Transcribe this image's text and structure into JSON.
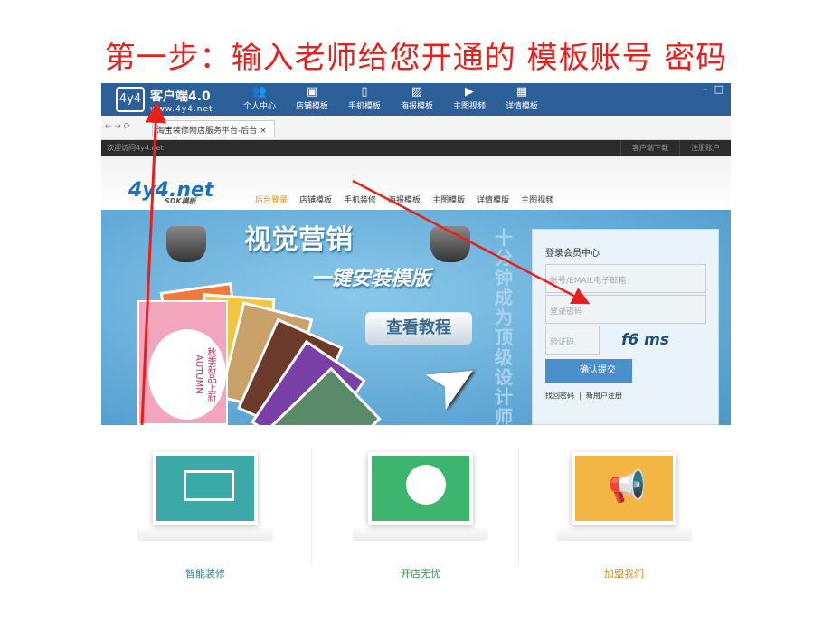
{
  "slide_title": "第一步：输入老师给您开通的 模板账号 密码",
  "app": {
    "logo": "4y4",
    "name": "客户端4.0",
    "url": "www.4y4.net",
    "nav": [
      {
        "label": "个人中心",
        "icon": "user-icon"
      },
      {
        "label": "店铺模板",
        "icon": "store-icon"
      },
      {
        "label": "手机模板",
        "icon": "phone-icon"
      },
      {
        "label": "海报模板",
        "icon": "image-icon"
      },
      {
        "label": "主图视频",
        "icon": "video-icon"
      },
      {
        "label": "详情模板",
        "icon": "picture-icon"
      }
    ],
    "window_controls": [
      "–",
      "□"
    ]
  },
  "browser": {
    "tab_title": "淘宝装修网店服务平台-后台",
    "close": "×"
  },
  "site": {
    "welcome": "欢迎访问4y4.net",
    "top_links": [
      "客户端下载",
      "注册账户"
    ],
    "logo": "4y4.net",
    "logo_sub": "SDK模板",
    "nav": [
      "后台登录",
      "店铺模板",
      "手机装修",
      "海报模板",
      "主图模版",
      "详情模版",
      "主图视频"
    ],
    "banner": {
      "headline": "视觉营销",
      "subhead": "一键安装模版",
      "tutorial_button": "查看教程",
      "vertical_text": "十分钟成为顶级设计师",
      "card_text": "秋季新品上新",
      "card_en": "AUTUMN"
    },
    "login": {
      "title": "登录会员中心",
      "account_placeholder": "帐号/EMAIL电子邮箱",
      "password_placeholder": "登录密码",
      "captcha_placeholder": "验证码",
      "captcha": "f6 ms",
      "submit": "确认提交",
      "forgot": "找回密码",
      "register": "新用户注册"
    }
  },
  "features": [
    {
      "label": "智能装修",
      "color": "#3aa9a8",
      "label_color": "#2f8a8a"
    },
    {
      "label": "开店无忧",
      "color": "#3db56e",
      "label_color": "#2b9a50"
    },
    {
      "label": "加盟我们",
      "color": "#f3b544",
      "label_color": "#e08a1a"
    }
  ],
  "accent": "#e8201c"
}
